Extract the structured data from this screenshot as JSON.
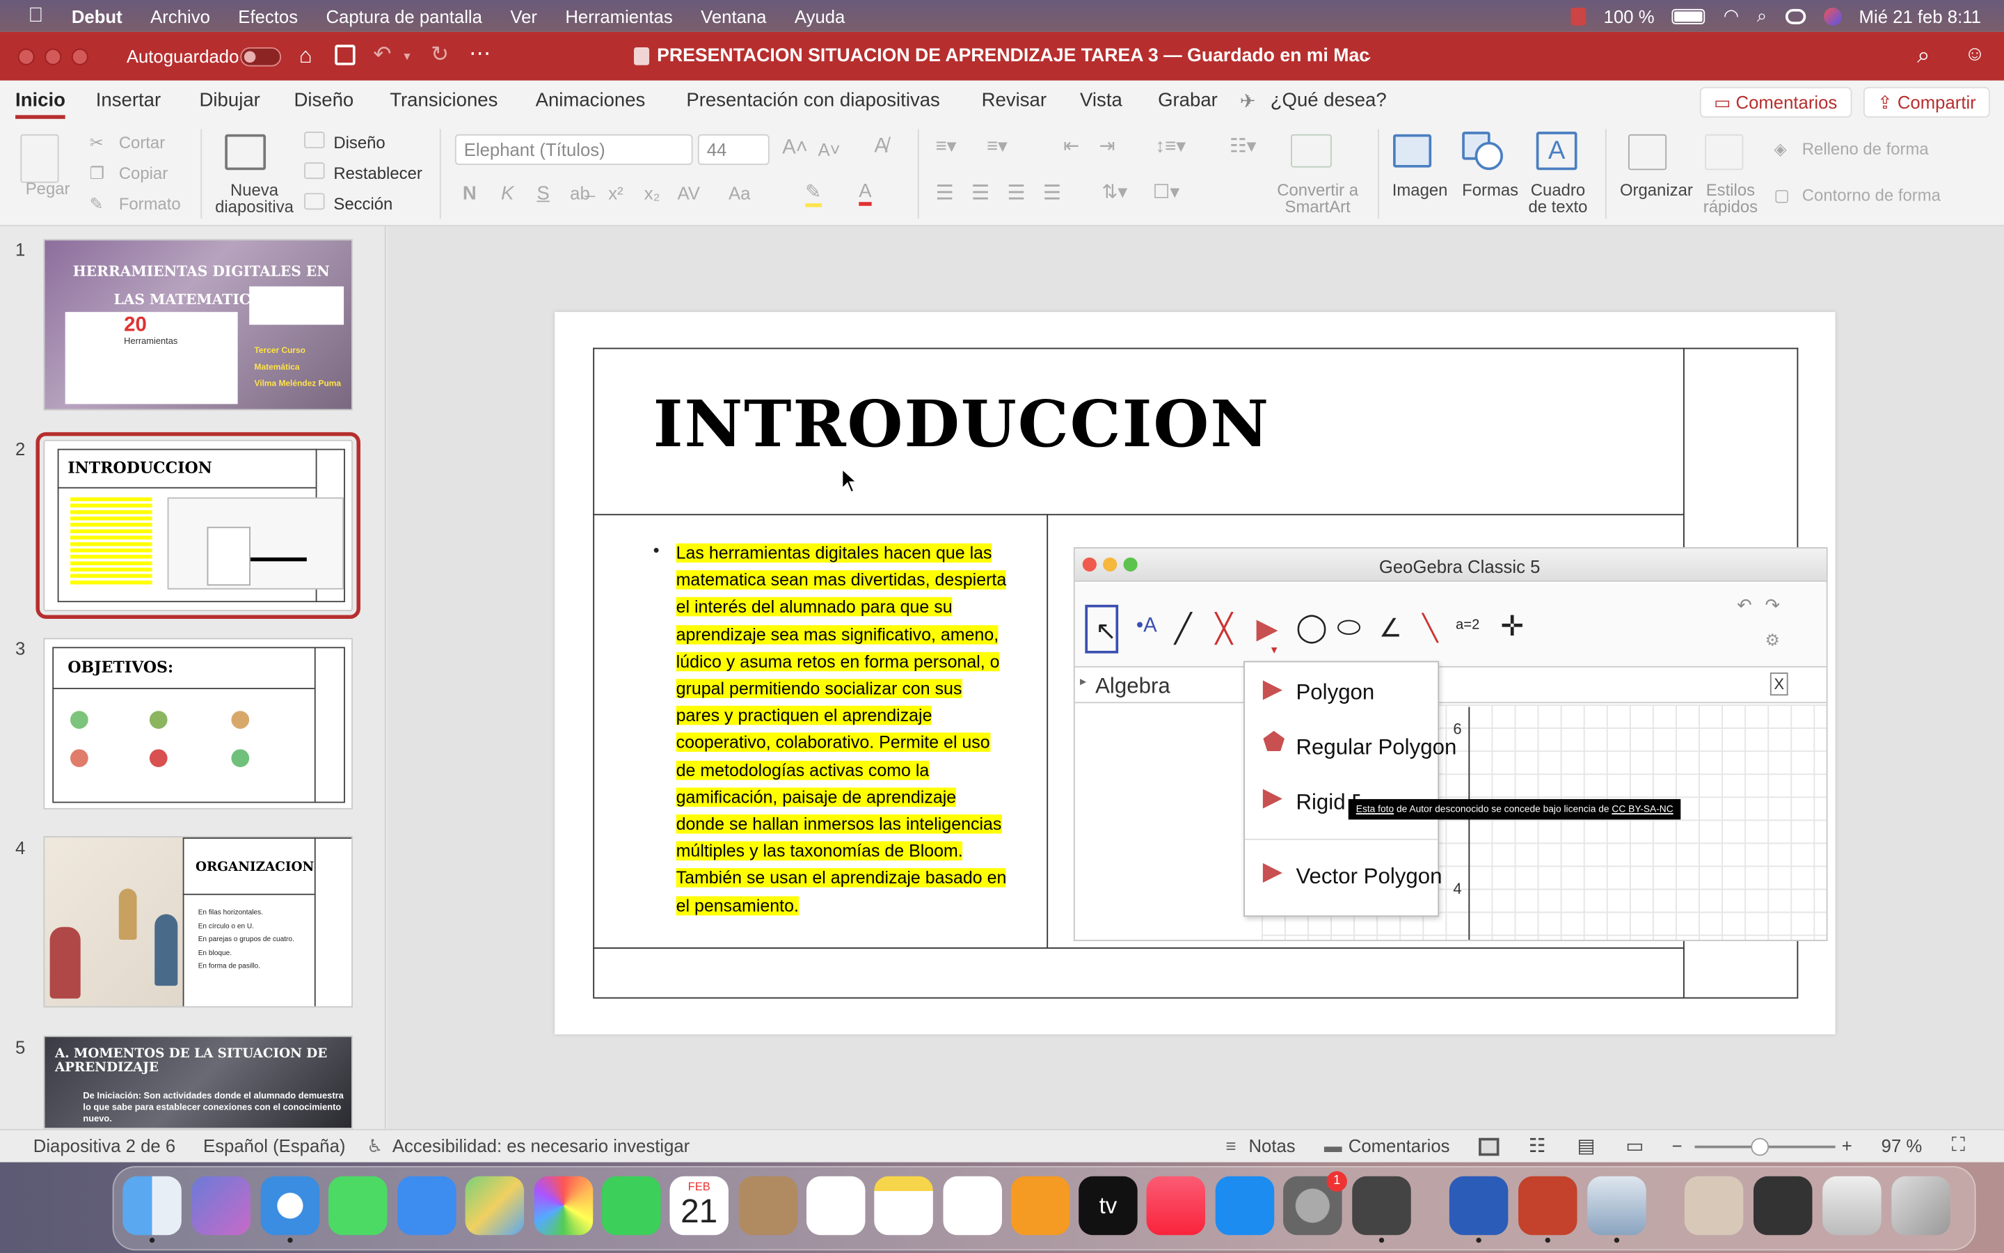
{
  "menubar": {
    "app": "Debut",
    "items": [
      "Archivo",
      "Efectos",
      "Captura de pantalla",
      "Ver",
      "Herramientas",
      "Ventana",
      "Ayuda"
    ],
    "battery": "100 %",
    "datetime": "Mié 21 feb 8:11"
  },
  "window": {
    "autosave_label": "Autoguardado",
    "title": "PRESENTACION SITUACION DE APRENDIZAJE TAREA 3 — Guardado en mi Mac"
  },
  "ribbon_tabs": {
    "items": [
      "Inicio",
      "Insertar",
      "Dibujar",
      "Diseño",
      "Transiciones",
      "Animaciones",
      "Presentación con diapositivas",
      "Revisar",
      "Vista",
      "Grabar"
    ],
    "tellme": "¿Qué desea?",
    "comments": "Comentarios",
    "share": "Compartir"
  },
  "ribbon": {
    "paste": "Pegar",
    "cut": "Cortar",
    "copy": "Copiar",
    "format": "Formato",
    "new_slide": "Nueva diapositiva",
    "layout": "Diseño",
    "reset": "Restablecer",
    "section": "Sección",
    "font": "Elephant (Títulos)",
    "font_size": "44",
    "bold": "N",
    "italic": "K",
    "underline": "S",
    "convert_smartart": "Convertir a SmartArt",
    "image": "Imagen",
    "shapes": "Formas",
    "textbox": "Cuadro de texto",
    "arrange": "Organizar",
    "quick_styles": "Estilos rápidos",
    "shape_fill": "Relleno de forma",
    "shape_outline": "Contorno de forma"
  },
  "thumbnails": [
    {
      "num": "1",
      "line1": "HERRAMIENTAS DIGITALES EN",
      "line2": "LAS MATEMATICAS",
      "big": "20",
      "small": "Herramientas",
      "side": [
        "Tercer Curso",
        "Matemática",
        "Vilma Meléndez Puma"
      ]
    },
    {
      "num": "2",
      "title": "INTRODUCCION"
    },
    {
      "num": "3",
      "title": "OBJETIVOS:"
    },
    {
      "num": "4",
      "title": "ORGANIZACION",
      "items": [
        "En filas horizontales.",
        "En círculo o en U.",
        "En parejas o grupos de cuatro.",
        "En bloque.",
        "En forma de pasillo."
      ]
    },
    {
      "num": "5",
      "title": "A.  MOMENTOS DE LA SITUACION DE APRENDIZAJE",
      "body": "De Iniciación: Son actividades donde el alumnado demuestra lo que sabe para establecer conexiones con el conocimiento nuevo."
    }
  ],
  "slide": {
    "title": "INTRODUCCION",
    "bullet_lines": [
      "Las herramientas digitales hacen que las",
      "matematica sean mas divertidas, despierta",
      "el interés del alumnado para que su",
      "aprendizaje sea mas significativo, ameno,",
      "lúdico y asuma retos en forma personal, o",
      "grupal permitiendo socializar con sus",
      "pares y practiquen el aprendizaje",
      "cooperativo, colaborativo. Permite el uso",
      "de metodologías activas como la",
      "gamificación, paisaje de aprendizaje",
      "donde se hallan inmersos las inteligencias",
      "múltiples y las taxonomías de Bloom.",
      "También se usan el aprendizaje basado en",
      "el pensamiento."
    ]
  },
  "geogebra": {
    "title": "GeoGebra Classic 5",
    "algebra": "Algebra",
    "tool_label": "a=2",
    "close": "X",
    "axis_6": "6",
    "axis_4": "4",
    "menu": [
      "Polygon",
      "Regular Polygon",
      "Rigid Polygon",
      "Vector Polygon"
    ],
    "attribution_a": "Esta foto",
    "attribution_b": " de Autor desconocido se concede bajo licencia de ",
    "attribution_c": "CC BY-SA-NC"
  },
  "status": {
    "slide": "Diapositiva 2 de 6",
    "language": "Español (España)",
    "accessibility": "Accesibilidad: es necesario investigar",
    "notes": "Notas",
    "comments": "Comentarios",
    "zoom": "97 %"
  },
  "dock": {
    "calendar_month": "FEB",
    "calendar_day": "21",
    "tv": "tv",
    "settings_badge": "1"
  },
  "colors": {
    "accent": "#b72e2e",
    "highlight": "#ffff00"
  }
}
